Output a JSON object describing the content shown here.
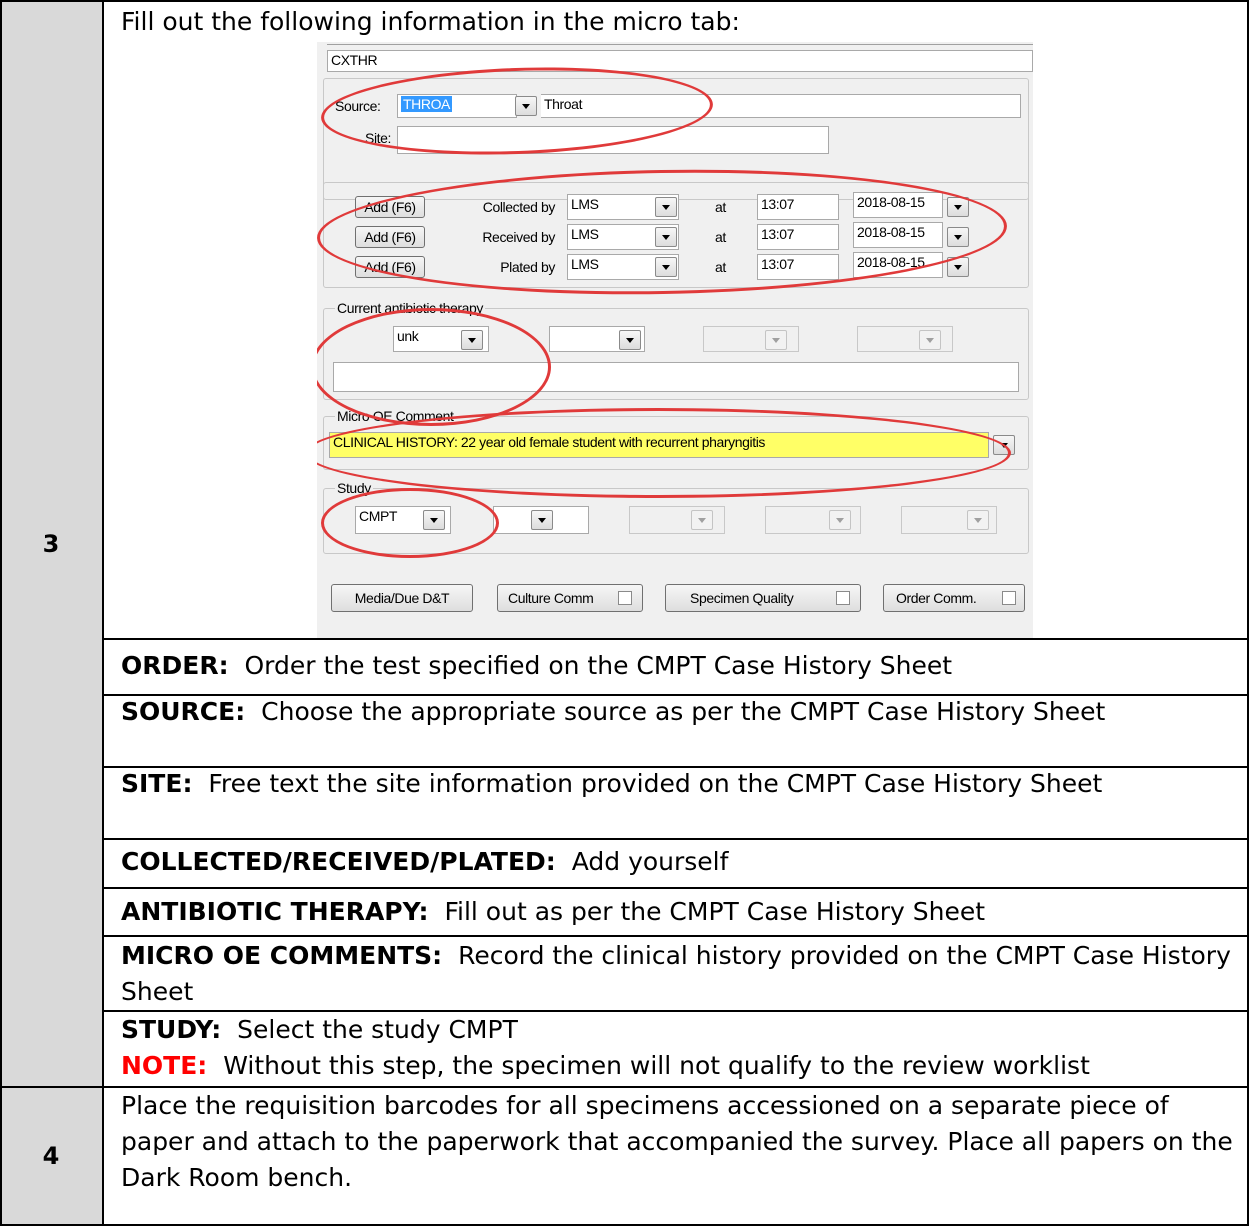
{
  "steps": {
    "step3_number": "3",
    "step4_number": "4"
  },
  "intro": "Fill out the following information in the micro tab:",
  "screenshot": {
    "test_code": "CXTHR",
    "source_label": "Source:",
    "source_code": "THROA",
    "source_desc": "Throat",
    "site_label": "Site:",
    "site_value": "",
    "collection_rows": [
      {
        "button": "Add (F6)",
        "label": "Collected by",
        "user": "LMS",
        "at": "at",
        "time": "13:07",
        "date": "2018-08-15"
      },
      {
        "button": "Add (F6)",
        "label": "Received by",
        "user": "LMS",
        "at": "at",
        "time": "13:07",
        "date": "2018-08-15"
      },
      {
        "button": "Add (F6)",
        "label": "Plated by",
        "user": "LMS",
        "at": "at",
        "time": "13:07",
        "date": "2018-08-15"
      }
    ],
    "antibiotic_legend": "Current antibiotic therapy",
    "antibiotic_value": "unk",
    "micro_legend": "Micro OE Comment",
    "micro_comment": "CLINICAL HISTORY:  22 year old female student with recurrent pharyngitis",
    "micro_comment_color": "#ffff66",
    "study_legend": "Study",
    "study_value": "CMPT",
    "buttons": {
      "media": "Media/Due D&T",
      "culture": "Culture Comm",
      "specimen": "Specimen Quality",
      "order": "Order Comm."
    },
    "annotation_color": "#e03a3a"
  },
  "instructions": {
    "order_label": "ORDER:",
    "order_text": "Order the test specified on the CMPT Case History Sheet",
    "source_label": "SOURCE:",
    "source_text": "Choose the appropriate source as per the CMPT Case History Sheet",
    "site_label": "SITE:",
    "site_text": "Free text the site information provided on the CMPT Case History Sheet",
    "collected_label": "COLLECTED/RECEIVED/PLATED:",
    "collected_text": "Add yourself",
    "antibiotic_label": "ANTIBIOTIC THERAPY:",
    "antibiotic_text": "Fill out as per the CMPT Case History Sheet",
    "micro_label": "MICRO OE COMMENTS:",
    "micro_text": "Record the clinical history provided on the CMPT Case History Sheet",
    "study_label": "STUDY:",
    "study_text": "Select the study CMPT",
    "note_label": "NOTE:",
    "note_text": "Without this step, the specimen will not qualify to the review worklist",
    "note_color": "#ff0000"
  },
  "step4_text": "Place the requisition barcodes for all specimens accessioned on a separate piece of paper and attach to the paperwork that accompanied the survey. Place all papers on the Dark Room bench."
}
